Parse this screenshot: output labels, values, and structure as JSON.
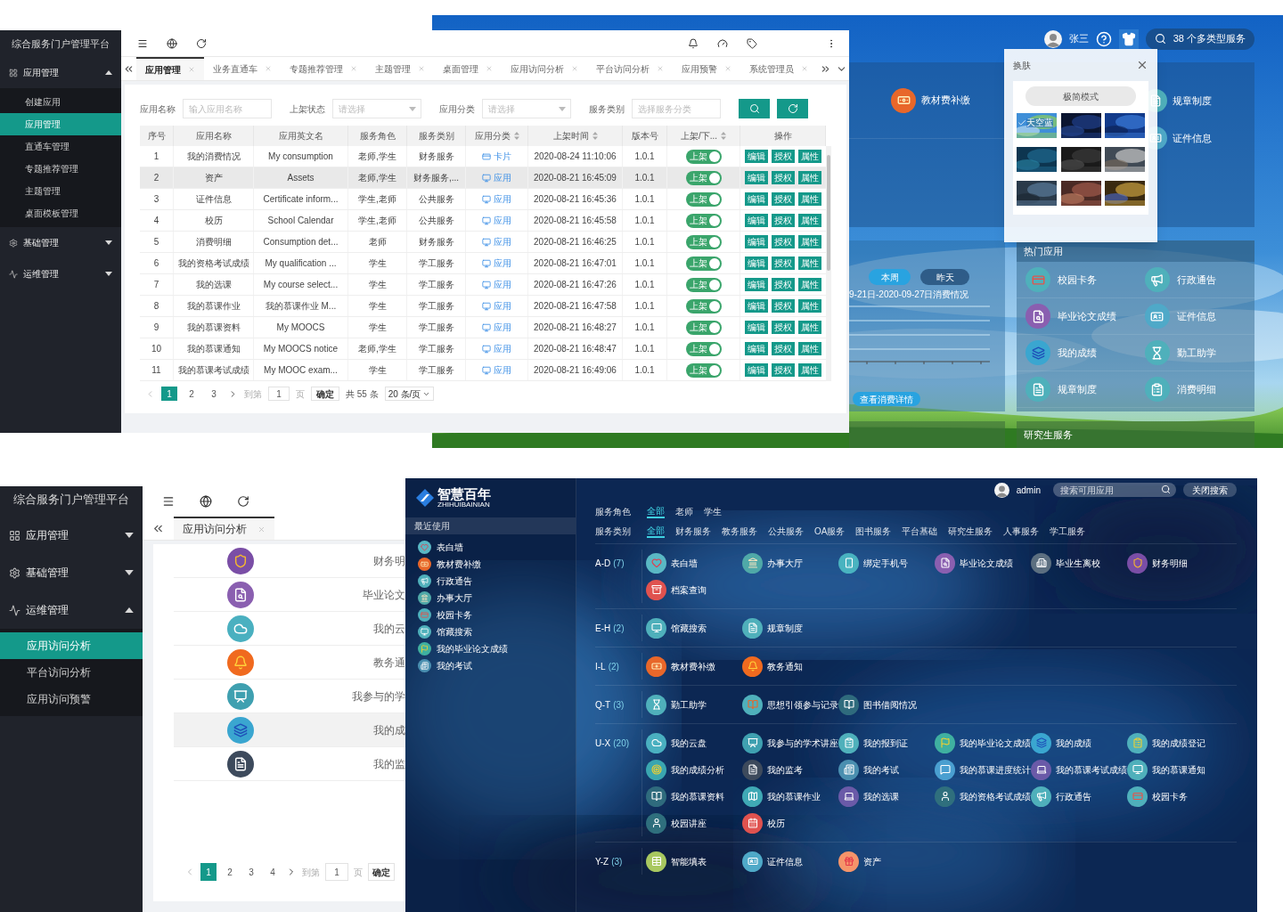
{
  "admin_top": {
    "sidebar": {
      "title": "综合服务门户管理平台",
      "groups": [
        {
          "label": "应用管理",
          "expanded": true,
          "children": [
            {
              "label": "创建应用",
              "selected": false
            },
            {
              "label": "应用管理",
              "selected": true
            },
            {
              "label": "直通车管理",
              "selected": false
            },
            {
              "label": "专题推荐管理",
              "selected": false
            },
            {
              "label": "主题管理",
              "selected": false
            },
            {
              "label": "桌面模板管理",
              "selected": false
            }
          ]
        },
        {
          "label": "基础管理",
          "expanded": false
        },
        {
          "label": "运维管理",
          "expanded": false
        }
      ]
    },
    "tabs": [
      {
        "label": "应用管理",
        "selected": true
      },
      {
        "label": "业务直通车",
        "selected": false
      },
      {
        "label": "专题推荐管理",
        "selected": false
      },
      {
        "label": "主题管理",
        "selected": false
      },
      {
        "label": "桌面管理",
        "selected": false
      },
      {
        "label": "应用访问分析",
        "selected": false
      },
      {
        "label": "平台访问分析",
        "selected": false
      },
      {
        "label": "应用预警",
        "selected": false
      },
      {
        "label": "系统管理员",
        "selected": false
      }
    ],
    "filters": [
      {
        "label": "应用名称",
        "placeholder": "输入应用名称",
        "kind": "text"
      },
      {
        "label": "上架状态",
        "placeholder": "请选择",
        "kind": "select"
      },
      {
        "label": "应用分类",
        "placeholder": "请选择",
        "kind": "select"
      },
      {
        "label": "服务类别",
        "placeholder": "选择服务分类",
        "kind": "text"
      }
    ],
    "table": {
      "columns": [
        {
          "label": "序号",
          "sortable": false
        },
        {
          "label": "应用名称",
          "sortable": false
        },
        {
          "label": "应用英文名",
          "sortable": false
        },
        {
          "label": "服务角色",
          "sortable": false
        },
        {
          "label": "服务类别",
          "sortable": false
        },
        {
          "label": "应用分类",
          "sortable": true
        },
        {
          "label": "上架时间",
          "sortable": true
        },
        {
          "label": "版本号",
          "sortable": false
        },
        {
          "label": "上架/下...",
          "sortable": true
        },
        {
          "label": "操作",
          "sortable": false
        }
      ],
      "rows": [
        {
          "no": "1",
          "name": "我的消费情况",
          "english": "My consumption",
          "roles": "老师,学生",
          "service": "财务服务",
          "category": {
            "kind": "card",
            "label": "卡片"
          },
          "time": "2020-08-24 11:10:06",
          "version": "1.0.1",
          "status": {
            "label": "上架",
            "on": true
          },
          "actions": [
            "编辑",
            "授权",
            "属性"
          ],
          "selected": false
        },
        {
          "no": "2",
          "name": "资产",
          "english": "Assets",
          "roles": "老师,学生",
          "service": "财务服务,...",
          "category": {
            "kind": "app",
            "label": "应用"
          },
          "time": "2020-08-21 16:45:09",
          "version": "1.0.1",
          "status": {
            "label": "上架",
            "on": true
          },
          "actions": [
            "编辑",
            "授权",
            "属性"
          ],
          "selected": true
        },
        {
          "no": "3",
          "name": "证件信息",
          "english": "Certificate inform...",
          "roles": "学生,老师",
          "service": "公共服务",
          "category": {
            "kind": "app",
            "label": "应用"
          },
          "time": "2020-08-21 16:45:36",
          "version": "1.0.1",
          "status": {
            "label": "上架",
            "on": true
          },
          "actions": [
            "编辑",
            "授权",
            "属性"
          ],
          "selected": false
        },
        {
          "no": "4",
          "name": "校历",
          "english": "School Calendar",
          "roles": "学生,老师",
          "service": "公共服务",
          "category": {
            "kind": "app",
            "label": "应用"
          },
          "time": "2020-08-21 16:45:58",
          "version": "1.0.1",
          "status": {
            "label": "上架",
            "on": true
          },
          "actions": [
            "编辑",
            "授权",
            "属性"
          ],
          "selected": false
        },
        {
          "no": "5",
          "name": "消费明细",
          "english": "Consumption det...",
          "roles": "老师",
          "service": "财务服务",
          "category": {
            "kind": "app",
            "label": "应用"
          },
          "time": "2020-08-21 16:46:25",
          "version": "1.0.1",
          "status": {
            "label": "上架",
            "on": true
          },
          "actions": [
            "编辑",
            "授权",
            "属性"
          ],
          "selected": false
        },
        {
          "no": "6",
          "name": "我的资格考试成绩",
          "english": "My qualification ...",
          "roles": "学生",
          "service": "学工服务",
          "category": {
            "kind": "app",
            "label": "应用"
          },
          "time": "2020-08-21 16:47:01",
          "version": "1.0.1",
          "status": {
            "label": "上架",
            "on": true
          },
          "actions": [
            "编辑",
            "授权",
            "属性"
          ],
          "selected": false
        },
        {
          "no": "7",
          "name": "我的选课",
          "english": "My course select...",
          "roles": "学生",
          "service": "学工服务",
          "category": {
            "kind": "app",
            "label": "应用"
          },
          "time": "2020-08-21 16:47:26",
          "version": "1.0.1",
          "status": {
            "label": "上架",
            "on": true
          },
          "actions": [
            "编辑",
            "授权",
            "属性"
          ],
          "selected": false
        },
        {
          "no": "8",
          "name": "我的慕课作业",
          "english": "我的慕课作业 M...",
          "roles": "学生",
          "service": "学工服务",
          "category": {
            "kind": "app",
            "label": "应用"
          },
          "time": "2020-08-21 16:47:58",
          "version": "1.0.1",
          "status": {
            "label": "上架",
            "on": true
          },
          "actions": [
            "编辑",
            "授权",
            "属性"
          ],
          "selected": false
        },
        {
          "no": "9",
          "name": "我的慕课资料",
          "english": "My MOOCS",
          "roles": "学生",
          "service": "学工服务",
          "category": {
            "kind": "app",
            "label": "应用"
          },
          "time": "2020-08-21 16:48:27",
          "version": "1.0.1",
          "status": {
            "label": "上架",
            "on": true
          },
          "actions": [
            "编辑",
            "授权",
            "属性"
          ],
          "selected": false
        },
        {
          "no": "10",
          "name": "我的慕课通知",
          "english": "My MOOCS notice",
          "roles": "老师,学生",
          "service": "学工服务",
          "category": {
            "kind": "app",
            "label": "应用"
          },
          "time": "2020-08-21 16:48:47",
          "version": "1.0.1",
          "status": {
            "label": "上架",
            "on": true
          },
          "actions": [
            "编辑",
            "授权",
            "属性"
          ],
          "selected": false
        },
        {
          "no": "11",
          "name": "我的慕课考试成绩",
          "english": "My MOOC exam...",
          "roles": "学生",
          "service": "学工服务",
          "category": {
            "kind": "app",
            "label": "应用"
          },
          "time": "2020-08-21 16:49:06",
          "version": "1.0.1",
          "status": {
            "label": "上架",
            "on": true
          },
          "actions": [
            "编辑",
            "授权",
            "属性"
          ],
          "selected": false
        }
      ]
    },
    "pagination": {
      "pages": [
        {
          "label": "1",
          "selected": true
        },
        {
          "label": "2",
          "selected": false
        },
        {
          "label": "3",
          "selected": false
        }
      ],
      "goto_label": "到第",
      "goto_value": "1",
      "page_unit": "页",
      "confirm": "确定",
      "total": "共 55 条",
      "page_size": "20 条/页"
    }
  },
  "portal_top": {
    "user": "张三",
    "search_text": "38 个多类型服务",
    "apps_left": [
      {
        "label": "教材费补缴"
      }
    ],
    "apps_right": [
      {
        "label": "规章制度"
      },
      {
        "label": "证件信息"
      }
    ],
    "skin_popup": {
      "title": "换肤",
      "mode_button": "极简模式",
      "themes": [
        {
          "label": "天空蓝",
          "selected": true
        },
        {
          "selected": false
        },
        {
          "selected": false
        },
        {
          "selected": false
        },
        {
          "selected": false
        },
        {
          "selected": false
        },
        {
          "selected": false
        },
        {
          "selected": false
        },
        {
          "selected": false
        }
      ]
    },
    "consumption": {
      "ranges": [
        {
          "label": "本周",
          "selected": true
        },
        {
          "label": "昨天",
          "selected": false
        }
      ],
      "caption": "9-21日-2020-09-27日消费情况",
      "detail_button": "查看消费详情"
    },
    "hot_apps": {
      "title": "热门应用",
      "items": [
        {
          "label": "校园卡务"
        },
        {
          "label": "行政通告"
        },
        {
          "label": "毕业论文成绩"
        },
        {
          "label": "证件信息"
        },
        {
          "label": "我的成绩"
        },
        {
          "label": "勤工助学"
        },
        {
          "label": "规章制度"
        },
        {
          "label": "消费明细"
        }
      ]
    },
    "graduate": {
      "title": "研究生服务"
    }
  },
  "admin_bottom": {
    "sidebar": {
      "title": "综合服务门户管理平台",
      "groups": [
        {
          "label": "应用管理",
          "expanded": false
        },
        {
          "label": "基础管理",
          "expanded": false
        },
        {
          "label": "运维管理",
          "expanded": true,
          "children": [
            {
              "label": "应用访问分析",
              "selected": true
            },
            {
              "label": "平台访问分析",
              "selected": false
            },
            {
              "label": "应用访问预警",
              "selected": false
            }
          ]
        }
      ]
    },
    "tabs": [
      {
        "label": "应用访问分析",
        "selected": true
      }
    ],
    "rows": [
      {
        "label": "财务明",
        "selected": false
      },
      {
        "label": "毕业论文",
        "selected": false
      },
      {
        "label": "我的云",
        "selected": false
      },
      {
        "label": "教务通",
        "selected": false
      },
      {
        "label": "我参与的学",
        "selected": false
      },
      {
        "label": "我的成",
        "selected": true
      },
      {
        "label": "我的监",
        "selected": false
      }
    ],
    "pagination": {
      "pages": [
        {
          "label": "1",
          "selected": true
        },
        {
          "label": "2",
          "selected": false
        },
        {
          "label": "3",
          "selected": false
        },
        {
          "label": "4",
          "selected": false
        }
      ],
      "goto_label": "到第",
      "goto_value": "1",
      "page_unit": "页",
      "confirm": "确定"
    }
  },
  "portal_bottom": {
    "logo": {
      "name": "智慧百年",
      "subtitle": "ZHIHUIBAINIAN"
    },
    "recent_title": "最近使用",
    "recent": [
      {
        "label": "表白墙"
      },
      {
        "label": "教材费补缴"
      },
      {
        "label": "行政通告"
      },
      {
        "label": "办事大厅"
      },
      {
        "label": "校园卡务"
      },
      {
        "label": "馆藏搜索"
      },
      {
        "label": "我的毕业论文成绩"
      },
      {
        "label": "我的考试"
      }
    ],
    "user": "admin",
    "search_placeholder": "搜索可用应用",
    "close_search": "关闭搜索",
    "filters": [
      {
        "label": "服务角色",
        "options": [
          {
            "label": "全部",
            "selected": true
          },
          {
            "label": "老师",
            "selected": false
          },
          {
            "label": "学生",
            "selected": false
          }
        ]
      },
      {
        "label": "服务类别",
        "options": [
          {
            "label": "全部",
            "selected": true
          },
          {
            "label": "财务服务",
            "selected": false
          },
          {
            "label": "教务服务",
            "selected": false
          },
          {
            "label": "公共服务",
            "selected": false
          },
          {
            "label": "OA服务",
            "selected": false
          },
          {
            "label": "图书服务",
            "selected": false
          },
          {
            "label": "平台基础",
            "selected": false
          },
          {
            "label": "研究生服务",
            "selected": false
          },
          {
            "label": "人事服务",
            "selected": false
          },
          {
            "label": "学工服务",
            "selected": false
          }
        ]
      }
    ],
    "groups": [
      {
        "range": "A-D",
        "count": "(7)",
        "apps": [
          "表白墙",
          "办事大厅",
          "绑定手机号",
          "毕业论文成绩",
          "毕业生离校",
          "财务明细",
          "档案查询"
        ]
      },
      {
        "range": "E-H",
        "count": "(2)",
        "apps": [
          "馆藏搜索",
          "规章制度"
        ]
      },
      {
        "range": "I-L",
        "count": "(2)",
        "apps": [
          "教材费补缴",
          "教务通知"
        ]
      },
      {
        "range": "Q-T",
        "count": "(3)",
        "apps": [
          "勤工助学",
          "思想引领参与记录",
          "图书借阅情况"
        ]
      },
      {
        "range": "U-X",
        "count": "(20)",
        "apps": [
          "我的云盘",
          "我参与的学术讲座",
          "我的报到证",
          "我的毕业论文成绩",
          "我的成绩",
          "我的成绩登记",
          "我的成绩分析",
          "我的监考",
          "我的考试",
          "我的慕课进度统计",
          "我的慕课考试成绩",
          "我的慕课通知",
          "我的慕课资料",
          "我的慕课作业",
          "我的选课",
          "我的资格考试成绩",
          "行政通告",
          "校园卡务",
          "校园讲座",
          "校历"
        ]
      },
      {
        "range": "Y-Z",
        "count": "(3)",
        "apps": [
          "智能填表",
          "证件信息",
          "资产"
        ]
      }
    ]
  }
}
